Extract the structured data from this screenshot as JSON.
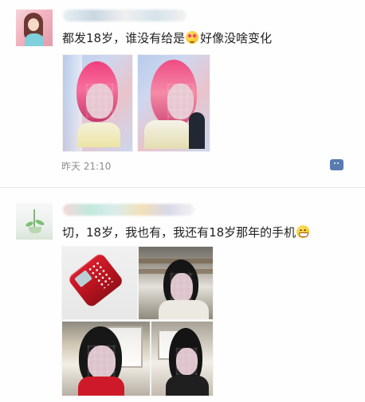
{
  "posts": [
    {
      "text_before_emoji": "都发18岁，谁没有给是",
      "text_after_emoji": "好像没啥变化",
      "timestamp": "昨天 21:10",
      "emoji": "heart-eyes-emoji"
    },
    {
      "text_before_emoji": "切，18岁，我也有，我还有18岁那年的手机",
      "text_after_emoji": "",
      "emoji": "grin-emoji"
    }
  ],
  "icons": {
    "comment": "comment-icon"
  },
  "colors": {
    "meta": "#8c8c8c",
    "comment_button": "#5a7bb0",
    "text": "#222222",
    "divider": "#e6e6e6"
  }
}
